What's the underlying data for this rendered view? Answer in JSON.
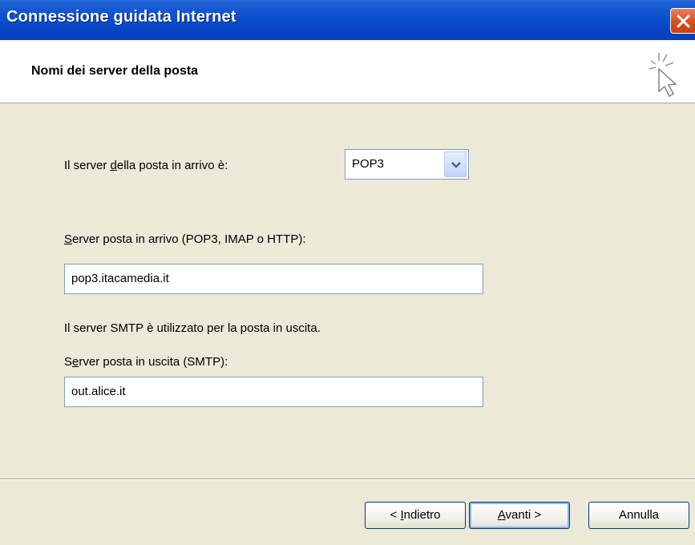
{
  "window": {
    "title": "Connessione guidata Internet"
  },
  "header": {
    "title": "Nomi dei server della posta"
  },
  "incoming_type": {
    "label_pre": "Il server ",
    "label_mnemonic": "d",
    "label_post": "ella posta in arrivo è:",
    "selected": "POP3"
  },
  "incoming_server": {
    "label_mnemonic": "S",
    "label_post": "erver posta in arrivo (POP3, IMAP o HTTP):",
    "value": "pop3.itacamedia.it"
  },
  "smtp_info": "Il server SMTP è utilizzato per la posta in uscita.",
  "outgoing_server": {
    "label_pre": "S",
    "label_mnemonic": "e",
    "label_post": "rver posta in uscita (SMTP):",
    "value": "out.alice.it"
  },
  "buttons": {
    "back_pre": "< ",
    "back_mnemonic": "I",
    "back_post": "ndietro",
    "next_mnemonic": "A",
    "next_post": "vanti >",
    "cancel": "Annulla"
  },
  "icons": {
    "close": "close-icon",
    "wizard": "cursor-sparkle-icon",
    "dropdown": "chevron-down-icon"
  },
  "colors": {
    "titlebar": "#0a4fd0",
    "close": "#d9531c",
    "body": "#ece9d8"
  }
}
